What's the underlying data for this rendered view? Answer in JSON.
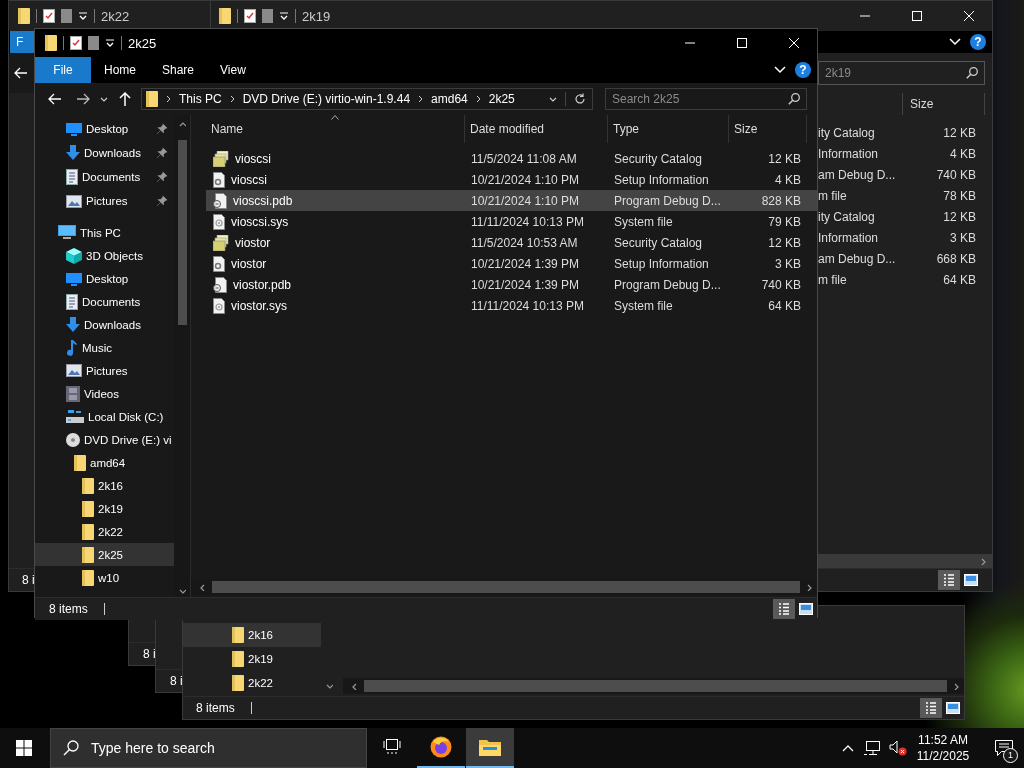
{
  "window_2k22": {
    "title": "2k22",
    "file_tab": "F",
    "status": "8 i"
  },
  "window_2k19": {
    "title": "2k19",
    "help": "?",
    "search": {
      "placeholder": "2k19"
    },
    "columns": [
      {
        "label": "Size"
      }
    ],
    "rows": [
      {
        "type": "ity Catalog",
        "size": "12 KB"
      },
      {
        "type": "Information",
        "size": "4 KB"
      },
      {
        "type": "am Debug D...",
        "size": "740 KB"
      },
      {
        "type": "m file",
        "size": "78 KB"
      },
      {
        "type": "ity Catalog",
        "size": "12 KB"
      },
      {
        "type": "Information",
        "size": "3 KB"
      },
      {
        "type": "am Debug D...",
        "size": "668 KB"
      },
      {
        "type": "m file",
        "size": "64 KB"
      }
    ],
    "views": [
      {
        "kind": "details",
        "selected": true
      },
      {
        "kind": "large_icons",
        "selected": false
      }
    ]
  },
  "stacked_windows": [
    {
      "status": "8 i"
    },
    {
      "status": "8 i"
    }
  ],
  "window_2k16": {
    "nav": [
      {
        "label": "2k16",
        "selected": true
      },
      {
        "label": "2k19",
        "selected": false
      },
      {
        "label": "2k22",
        "selected": false
      }
    ],
    "status": "8 items",
    "views": [
      {
        "kind": "details",
        "selected": true
      },
      {
        "kind": "large_icons",
        "selected": false
      }
    ]
  },
  "main_window": {
    "title": "2k25",
    "help": "?",
    "ribbon_tabs": [
      {
        "label": "File",
        "selected": true
      },
      {
        "label": "Home",
        "selected": false
      },
      {
        "label": "Share",
        "selected": false
      },
      {
        "label": "View",
        "selected": false
      }
    ],
    "address": {
      "crumbs": [
        "This PC",
        "DVD Drive (E:) virtio-win-1.9.44",
        "amd64",
        "2k25"
      ]
    },
    "search": {
      "placeholder": "Search 2k25"
    },
    "nav": {
      "pinned": [
        {
          "label": "Desktop",
          "kind": "desktop",
          "pinned": true,
          "selected": false
        },
        {
          "label": "Downloads",
          "kind": "downloads",
          "pinned": true,
          "selected": false
        },
        {
          "label": "Documents",
          "kind": "documents",
          "pinned": true,
          "selected": false
        },
        {
          "label": "Pictures",
          "kind": "pictures",
          "pinned": true,
          "selected": false
        }
      ],
      "tree": [
        {
          "label": "This PC",
          "kind": "computer",
          "selected": false,
          "children": [
            {
              "label": "3D Objects",
              "kind": "objects3d",
              "selected": false
            },
            {
              "label": "Desktop",
              "kind": "desktop",
              "selected": false
            },
            {
              "label": "Documents",
              "kind": "documents",
              "selected": false
            },
            {
              "label": "Downloads",
              "kind": "downloads",
              "selected": false
            },
            {
              "label": "Music",
              "kind": "music",
              "selected": false
            },
            {
              "label": "Pictures",
              "kind": "pictures",
              "selected": false
            },
            {
              "label": "Videos",
              "kind": "videos",
              "selected": false
            },
            {
              "label": "Local Disk (C:)",
              "kind": "disk",
              "selected": false
            },
            {
              "label": "DVD Drive (E:) vi",
              "kind": "dvd",
              "selected": false,
              "children": [
                {
                  "label": "amd64",
                  "kind": "folder",
                  "selected": false,
                  "children": [
                    {
                      "label": "2k16",
                      "kind": "folder",
                      "selected": false
                    },
                    {
                      "label": "2k19",
                      "kind": "folder",
                      "selected": false
                    },
                    {
                      "label": "2k22",
                      "kind": "folder",
                      "selected": false
                    },
                    {
                      "label": "2k25",
                      "kind": "folder",
                      "selected": true
                    },
                    {
                      "label": "w10",
                      "kind": "folder",
                      "selected": false
                    }
                  ]
                }
              ]
            }
          ]
        }
      ]
    },
    "columns": [
      {
        "label": "Name",
        "sorted": true
      },
      {
        "label": "Date modified",
        "sorted": false
      },
      {
        "label": "Type",
        "sorted": false
      },
      {
        "label": "Size",
        "sorted": false
      }
    ],
    "files": [
      {
        "name": "vioscsi",
        "kind": "catalog",
        "date": "11/5/2024 11:08 AM",
        "type": "Security Catalog",
        "size": "12 KB",
        "selected": false
      },
      {
        "name": "vioscsi",
        "kind": "setup",
        "date": "10/21/2024 1:10 PM",
        "type": "Setup Information",
        "size": "4 KB",
        "selected": false
      },
      {
        "name": "vioscsi.pdb",
        "kind": "pdb",
        "date": "10/21/2024 1:10 PM",
        "type": "Program Debug D...",
        "size": "828 KB",
        "selected": true
      },
      {
        "name": "vioscsi.sys",
        "kind": "sys",
        "date": "11/11/2024 10:13 PM",
        "type": "System file",
        "size": "79 KB",
        "selected": false
      },
      {
        "name": "viostor",
        "kind": "catalog",
        "date": "11/5/2024 10:53 AM",
        "type": "Security Catalog",
        "size": "12 KB",
        "selected": false
      },
      {
        "name": "viostor",
        "kind": "setup",
        "date": "10/21/2024 1:39 PM",
        "type": "Setup Information",
        "size": "3 KB",
        "selected": false
      },
      {
        "name": "viostor.pdb",
        "kind": "pdb",
        "date": "10/21/2024 1:39 PM",
        "type": "Program Debug D...",
        "size": "740 KB",
        "selected": false
      },
      {
        "name": "viostor.sys",
        "kind": "sys",
        "date": "11/11/2024 10:13 PM",
        "type": "System file",
        "size": "64 KB",
        "selected": false
      }
    ],
    "status": "8 items",
    "views": [
      {
        "kind": "details",
        "selected": true
      },
      {
        "kind": "large_icons",
        "selected": false
      }
    ]
  },
  "taskbar": {
    "search": {
      "placeholder": "Type here to search"
    },
    "apps": [
      {
        "kind": "task_view",
        "running": false,
        "active": false
      },
      {
        "kind": "browser",
        "running": true,
        "active": false
      },
      {
        "kind": "explorer",
        "running": true,
        "active": true
      }
    ],
    "tray": [
      {
        "kind": "chevron"
      },
      {
        "kind": "network"
      },
      {
        "kind": "volume_muted"
      }
    ],
    "clock": {
      "time": "11:52 AM",
      "date": "11/2/2025"
    },
    "notifications": {
      "count": "1"
    }
  }
}
